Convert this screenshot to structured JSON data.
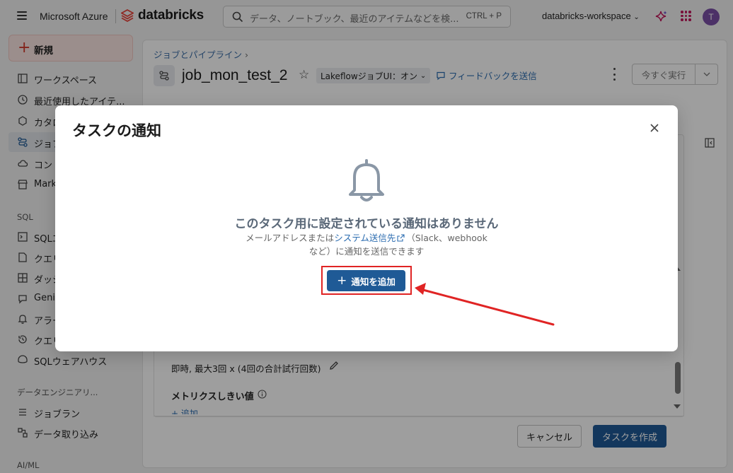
{
  "topbar": {
    "brand": "Microsoft Azure",
    "product": "databricks",
    "search_placeholder": "データ、ノートブック、最近のアイテムなどを検...",
    "search_shortcut": "CTRL + P",
    "workspace": "databricks-workspace",
    "avatar_initial": "T"
  },
  "sidebar": {
    "new_label": "新規",
    "items": [
      {
        "label": "ワークスペース",
        "icon": "folder-icon"
      },
      {
        "label": "最近使用したアイテ...",
        "icon": "clock-icon"
      },
      {
        "label": "カタロ",
        "icon": "catalog-icon"
      },
      {
        "label": "ジョブ",
        "icon": "jobs-icon"
      },
      {
        "label": "コン",
        "icon": "cloud-icon"
      },
      {
        "label": "Mark",
        "icon": "store-icon"
      }
    ],
    "sql_section": "SQL",
    "sql_items": [
      {
        "label": "SQLエ",
        "icon": "sql-editor-icon"
      },
      {
        "label": "クエリ",
        "icon": "query-icon"
      },
      {
        "label": "ダッシ",
        "icon": "dashboard-icon"
      },
      {
        "label": "Genie",
        "icon": "genie-icon"
      },
      {
        "label": "アラー",
        "icon": "bell-icon"
      },
      {
        "label": "クエリ",
        "icon": "history-icon"
      },
      {
        "label": "SQLウェアハウス",
        "icon": "warehouse-icon"
      }
    ],
    "de_section": "データエンジニアリ...",
    "de_items": [
      {
        "label": "ジョブラン",
        "icon": "job-runs-icon"
      },
      {
        "label": "データ取り込み",
        "icon": "ingest-icon"
      }
    ],
    "aiml_section": "AI/ML"
  },
  "main": {
    "breadcrumb": "ジョブとパイプライン",
    "breadcrumb_sep": "›",
    "job_title": "job_mon_test_2",
    "lakeflow_label": "LakeflowジョブUI：オン",
    "feedback_label": "フィードバックを送信",
    "run_now_label": "今すぐ実行",
    "retry_text": "即時, 最大3回 x (4回の合計試行回数)",
    "metrics_title": "メトリクスしきい値",
    "add_link": "+ 追加",
    "cancel_label": "キャンセル",
    "create_task_label": "タスクを作成"
  },
  "modal": {
    "title": "タスクの通知",
    "empty_title": "このタスク用に設定されている通知はありません",
    "desc_prefix": "メールアドレスまたは",
    "desc_link": "システム送信先",
    "desc_suffix": "（Slack、webhook",
    "desc_line2": "など）に通知を送信できます",
    "add_button": "通知を追加"
  },
  "colors": {
    "primary": "#1f5a96",
    "highlight_red": "#e02424",
    "new_button_bg": "#fbe6e3",
    "link": "#2b6cb0"
  }
}
